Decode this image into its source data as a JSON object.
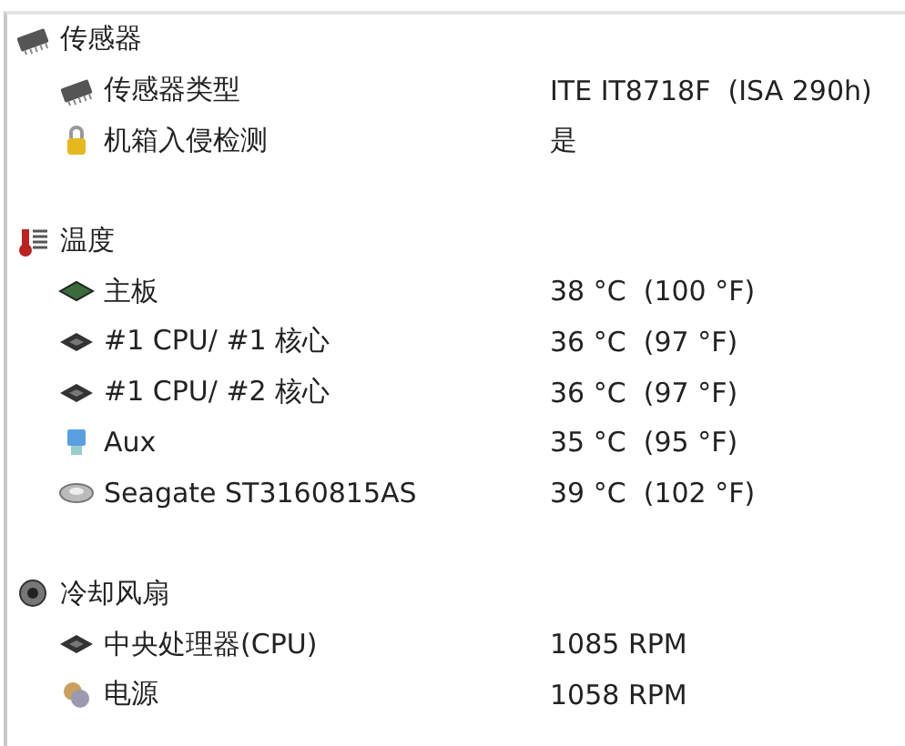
{
  "groups": [
    {
      "label": "传感器",
      "items": [
        {
          "label": "传感器类型",
          "value": "ITE IT8718F  (ISA 290h)"
        },
        {
          "label": "机箱入侵检测",
          "value": "是"
        }
      ]
    },
    {
      "label": "温度",
      "items": [
        {
          "label": "主板",
          "value": "38 °C  (100 °F)"
        },
        {
          "label": "#1 CPU/ #1 核心",
          "value": "36 °C  (97 °F)"
        },
        {
          "label": "#1 CPU/ #2 核心",
          "value": "36 °C  (97 °F)"
        },
        {
          "label": "Aux",
          "value": "35 °C  (95 °F)"
        },
        {
          "label": "Seagate ST3160815AS",
          "value": "39 °C  (102 °F)"
        }
      ]
    },
    {
      "label": "冷却风扇",
      "items": [
        {
          "label": "中央处理器(CPU)",
          "value": "1085 RPM"
        },
        {
          "label": "电源",
          "value": "1058 RPM"
        }
      ]
    }
  ]
}
